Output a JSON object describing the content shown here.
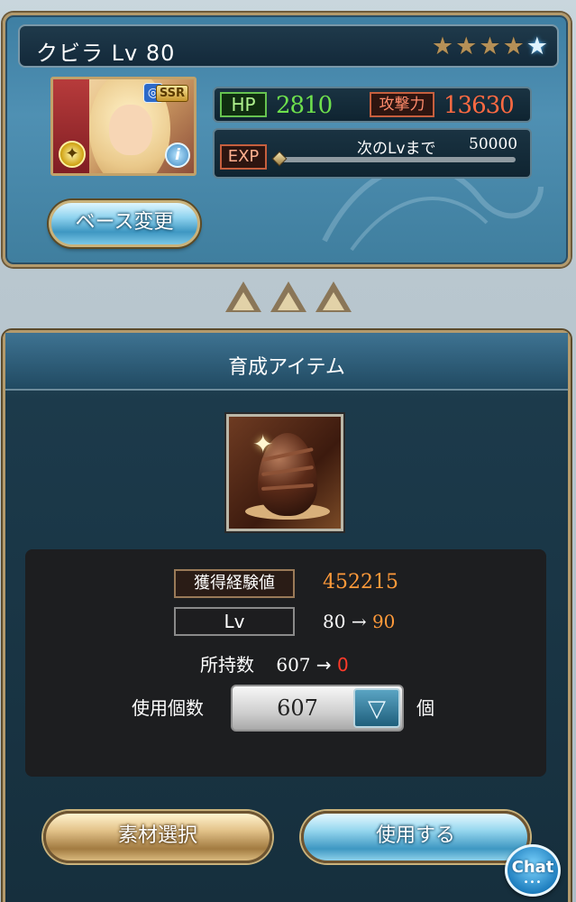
{
  "character": {
    "name": "クビラ",
    "level_label": "Lv 80",
    "stars": [
      "★",
      "★",
      "★",
      "★",
      "★"
    ],
    "rarity": "SSR",
    "hp_label": "HP",
    "hp": "2810",
    "atk_label": "攻撃力",
    "atk": "13630",
    "exp_label": "EXP",
    "next_level_text": "次のLvまで",
    "next_level_value": "50000",
    "base_change_label": "ベース変更"
  },
  "item_panel": {
    "title": "育成アイテム",
    "exp_gain_label": "獲得経験値",
    "exp_gain_value": "452215",
    "lv_label": "Lv",
    "lv_from": "80",
    "lv_arrow": "→",
    "lv_to": "90",
    "owned_label": "所持数",
    "owned_from": "607",
    "owned_arrow": "→",
    "owned_to": "0",
    "use_count_label": "使用個数",
    "use_count_value": "607",
    "unit": "個"
  },
  "buttons": {
    "select_material": "素材選択",
    "use": "使用する"
  },
  "chat": {
    "label": "Chat",
    "dots": "•••"
  },
  "colors": {
    "hp_value": "#6ee04d",
    "atk_value": "#ff6a42",
    "accent_orange": "#ff9a3a",
    "accent_red": "#ff3a2a"
  }
}
